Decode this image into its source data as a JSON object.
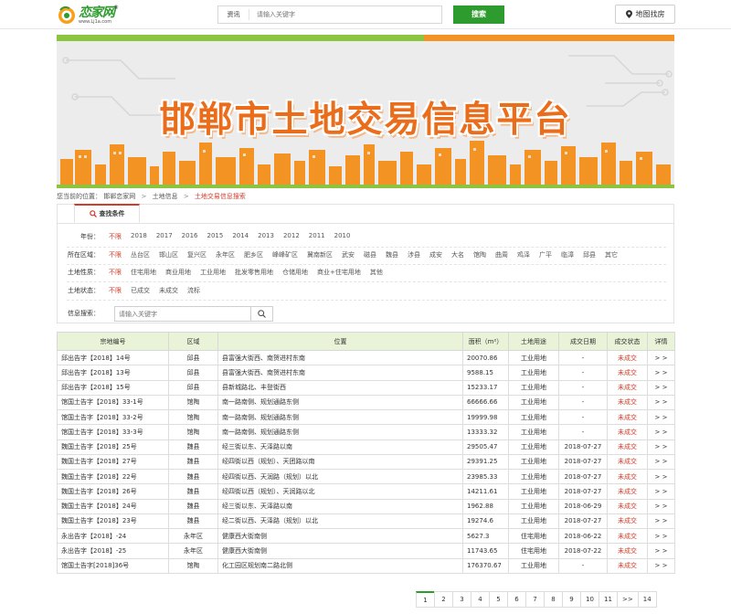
{
  "header": {
    "logo_text": "恋家网",
    "logo_url": "www.Lj1a.com",
    "logo_reg": "®",
    "search_category": "资讯",
    "search_placeholder": "请输入关键字",
    "search_button": "搜索",
    "map_button": "地图找房"
  },
  "banner": {
    "title": "邯郸市土地交易信息平台"
  },
  "breadcrumb": {
    "prefix": "您当前的位置：",
    "items": [
      "邯郸恋家网",
      "土地信息",
      "土地交易信息搜索"
    ],
    "sep": ">"
  },
  "filter": {
    "tab_label": "查找条件",
    "rows": [
      {
        "label": "年份：",
        "options": [
          "不限",
          "2018",
          "2017",
          "2016",
          "2015",
          "2014",
          "2013",
          "2012",
          "2011",
          "2010"
        ],
        "selected": 0
      },
      {
        "label": "所在区域：",
        "options": [
          "不限",
          "丛台区",
          "邯山区",
          "复兴区",
          "永年区",
          "肥乡区",
          "峰峰矿区",
          "冀南新区",
          "武安",
          "磁县",
          "魏县",
          "涉县",
          "成安",
          "大名",
          "馆陶",
          "曲周",
          "鸡泽",
          "广平",
          "临漳",
          "邱县",
          "其它"
        ],
        "selected": 0
      },
      {
        "label": "土地性质：",
        "options": [
          "不限",
          "住宅用地",
          "商业用地",
          "工业用地",
          "批发零售用地",
          "仓储用地",
          "商业+住宅用地",
          "其他"
        ],
        "selected": 0
      },
      {
        "label": "土地状态：",
        "options": [
          "不限",
          "已成交",
          "未成交",
          "流标"
        ],
        "selected": 0
      }
    ],
    "keyword_label": "信息搜索：",
    "keyword_placeholder": "请输入关键字"
  },
  "table": {
    "headers": [
      "宗地编号",
      "区域",
      "位置",
      "面积（m²）",
      "土地用途",
      "成交日期",
      "成交状态",
      "详情"
    ],
    "rows": [
      [
        "邱出告字【2018】14号",
        "邱县",
        "县富强大街西、南贺进村东南",
        "20070.86",
        "工业用地",
        "-",
        "未成交",
        "> >"
      ],
      [
        "邱出告字【2018】13号",
        "邱县",
        "县富强大街西、南贺进村东南",
        "9588.15",
        "工业用地",
        "-",
        "未成交",
        "> >"
      ],
      [
        "邱出告字【2018】15号",
        "邱县",
        "县新城路北、丰登街西",
        "15233.17",
        "工业用地",
        "-",
        "未成交",
        "> >"
      ],
      [
        "馆国土告字【2018】33-1号",
        "馆陶",
        "南一路南侧、规划通路东侧",
        "66666.66",
        "工业用地",
        "-",
        "未成交",
        "> >"
      ],
      [
        "馆国土告字【2018】33-2号",
        "馆陶",
        "南一路南侧、规划通路东侧",
        "19999.98",
        "工业用地",
        "-",
        "未成交",
        "> >"
      ],
      [
        "馆国土告字【2018】33-3号",
        "馆陶",
        "南一路南侧、规划通路东侧",
        "13333.32",
        "工业用地",
        "-",
        "未成交",
        "> >"
      ],
      [
        "魏国土告字【2018】25号",
        "魏县",
        "经三街以东、天泽路以南",
        "29505.47",
        "工业用地",
        "2018-07-27",
        "未成交",
        "> >"
      ],
      [
        "魏国土告字【2018】27号",
        "魏县",
        "经四街以西（规划）、天团路以南",
        "29391.25",
        "工业用地",
        "2018-07-27",
        "未成交",
        "> >"
      ],
      [
        "魏国土告字【2018】22号",
        "魏县",
        "经四街以西、天润路（规划）以北",
        "23985.33",
        "工业用地",
        "2018-07-27",
        "未成交",
        "> >"
      ],
      [
        "魏国土告字【2018】26号",
        "魏县",
        "经四街以西（规划）、天润路以北",
        "14211.61",
        "工业用地",
        "2018-07-27",
        "未成交",
        "> >"
      ],
      [
        "魏国土告字【2018】24号",
        "魏县",
        "经三街以东、天泽路以南",
        "1962.88",
        "工业用地",
        "2018-06-29",
        "未成交",
        "> >"
      ],
      [
        "魏国土告字【2018】23号",
        "魏县",
        "经二街以西、天泽路（规划）以北",
        "19274.6",
        "工业用地",
        "2018-07-27",
        "未成交",
        "> >"
      ],
      [
        "永出告字【2018】-24",
        "永年区",
        "健康西大街南侧",
        "5627.3",
        "住宅用地",
        "2018-06-22",
        "未成交",
        "> >"
      ],
      [
        "永出告字【2018】-25",
        "永年区",
        "健康西大街南侧",
        "11743.65",
        "住宅用地",
        "2018-07-22",
        "未成交",
        "> >"
      ],
      [
        "馆国土告字[2018]36号",
        "馆陶",
        "化工园区规划南二路北侧",
        "176370.67",
        "工业用地",
        "-",
        "未成交",
        "> >"
      ]
    ]
  },
  "pagination": {
    "pages": [
      "1",
      "2",
      "3",
      "4",
      "5",
      "6",
      "7",
      "8",
      "9",
      "10",
      "11",
      ">>",
      "14"
    ],
    "current": "1"
  },
  "colors": {
    "brand_green": "#2e9b2e",
    "accent_red": "#d23c2a",
    "banner_orange": "#ea6d1b",
    "table_header_bg": "#e8f3d7"
  }
}
